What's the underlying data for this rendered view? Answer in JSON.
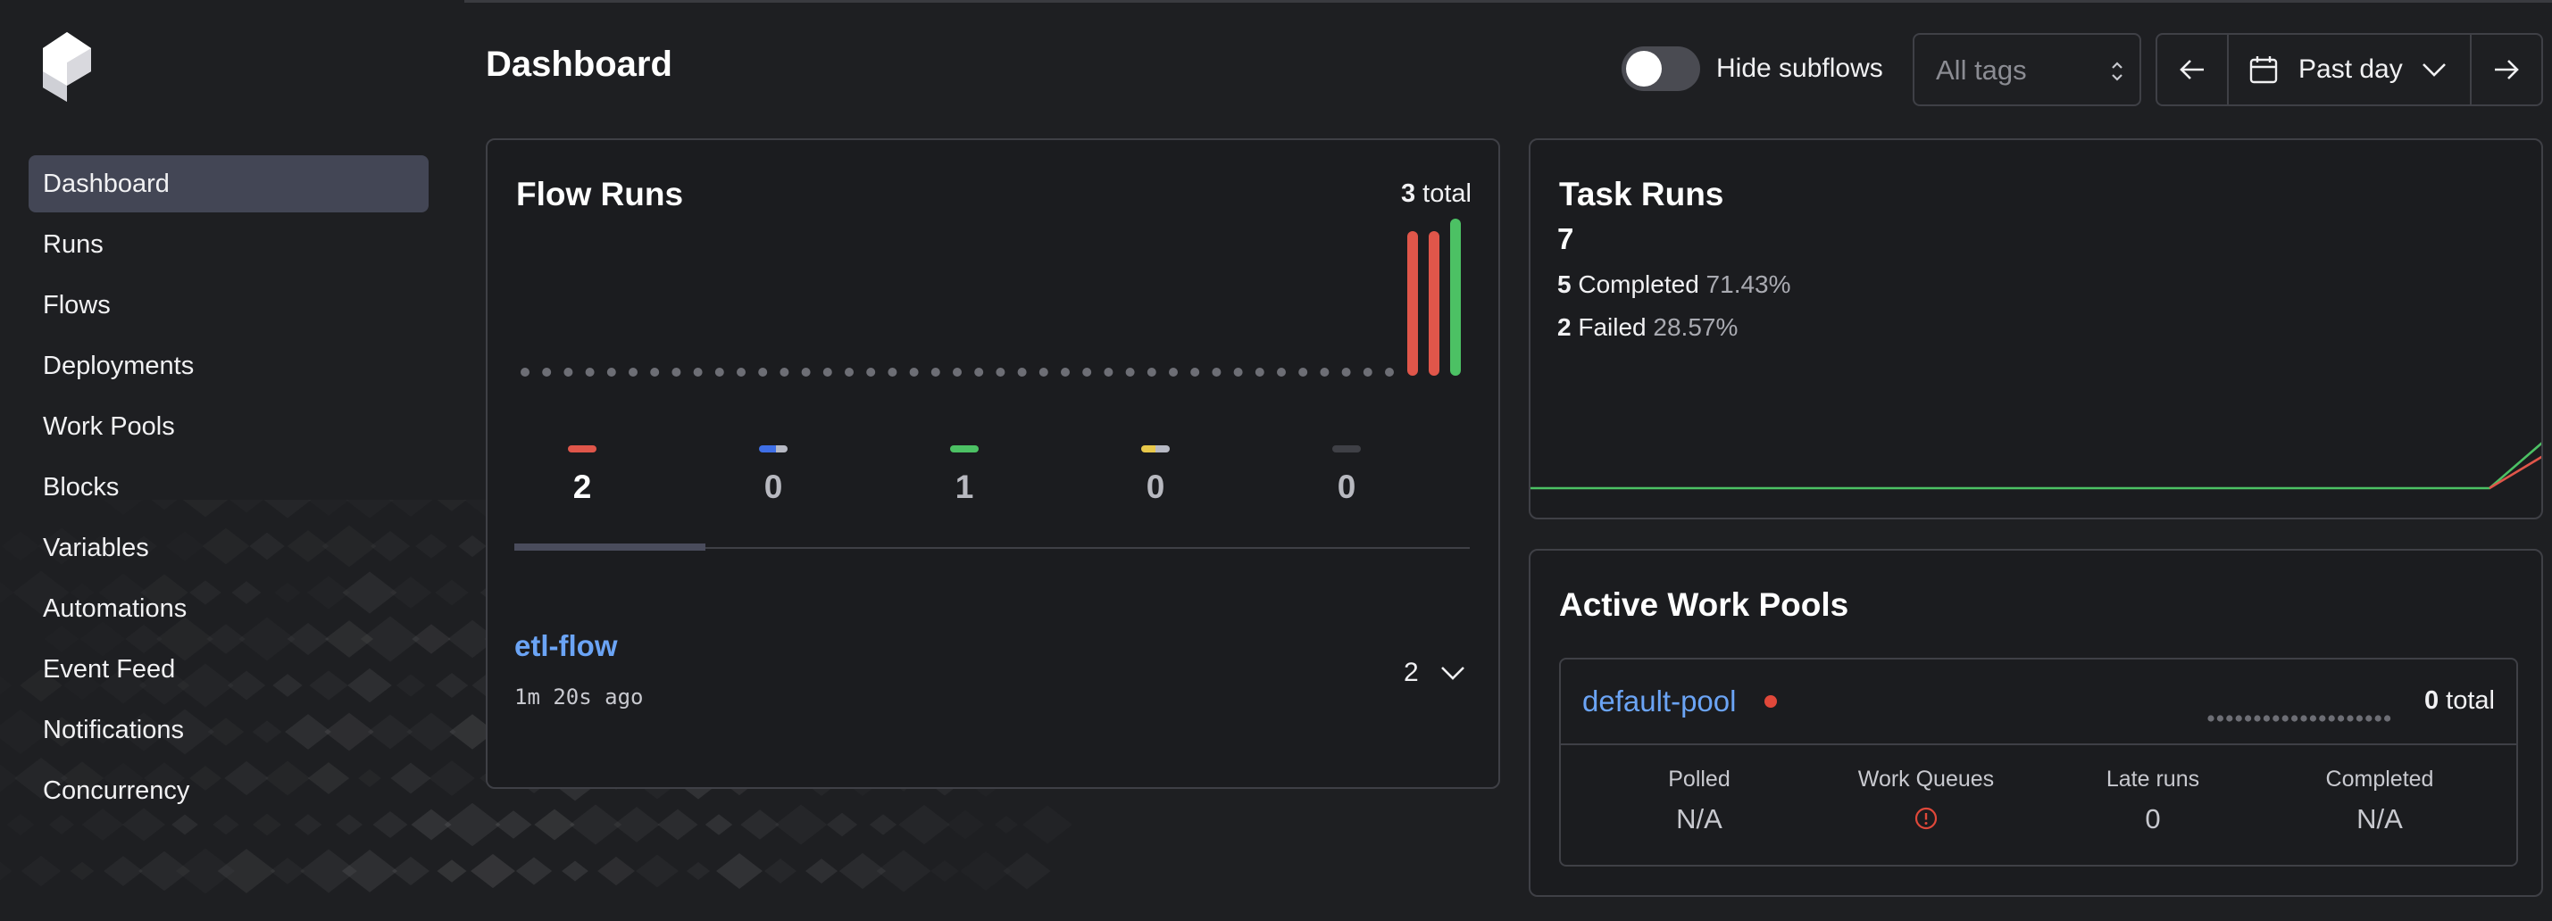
{
  "sidebar": {
    "items": [
      {
        "label": "Dashboard",
        "active": true
      },
      {
        "label": "Runs"
      },
      {
        "label": "Flows"
      },
      {
        "label": "Deployments"
      },
      {
        "label": "Work Pools"
      },
      {
        "label": "Blocks"
      },
      {
        "label": "Variables"
      },
      {
        "label": "Automations"
      },
      {
        "label": "Event Feed"
      },
      {
        "label": "Notifications"
      },
      {
        "label": "Concurrency"
      }
    ]
  },
  "header": {
    "title": "Dashboard",
    "hide_subflows_label": "Hide subflows",
    "hide_subflows_on": false,
    "tags_placeholder": "All tags",
    "date_range_label": "Past day"
  },
  "flow_runs": {
    "title": "Flow Runs",
    "total_count": "3",
    "total_suffix": "total",
    "states": [
      {
        "count": "2",
        "color": "#e0564a",
        "selected": true
      },
      {
        "count": "0",
        "color": "#3f6fe6"
      },
      {
        "count": "1",
        "color": "#4cc164"
      },
      {
        "count": "0",
        "color": "#e8c84a"
      },
      {
        "count": "0",
        "color": "#3f4046"
      }
    ],
    "flows": [
      {
        "name": "etl-flow",
        "time_ago": "1m 20s ago",
        "run_count": "2"
      }
    ]
  },
  "task_runs": {
    "title": "Task Runs",
    "total": "7",
    "completed_count": "5",
    "completed_label": "Completed",
    "completed_pct": "71.43%",
    "failed_count": "2",
    "failed_label": "Failed",
    "failed_pct": "28.57%"
  },
  "work_pools": {
    "title": "Active Work Pools",
    "pools": [
      {
        "name": "default-pool",
        "status_color": "#e0483a",
        "total_count": "0",
        "total_suffix": "total",
        "stats": [
          {
            "label": "Polled",
            "value": "N/A"
          },
          {
            "label": "Work Queues",
            "value": "",
            "icon": "alert-circle-icon"
          },
          {
            "label": "Late runs",
            "value": "0"
          },
          {
            "label": "Completed",
            "value": "N/A"
          }
        ]
      }
    ]
  },
  "colors": {
    "background": "#1e1f22",
    "accent_link": "#6ba4f5",
    "failed": "#e0564a",
    "completed": "#4cc164",
    "nav_active": "#434655"
  }
}
